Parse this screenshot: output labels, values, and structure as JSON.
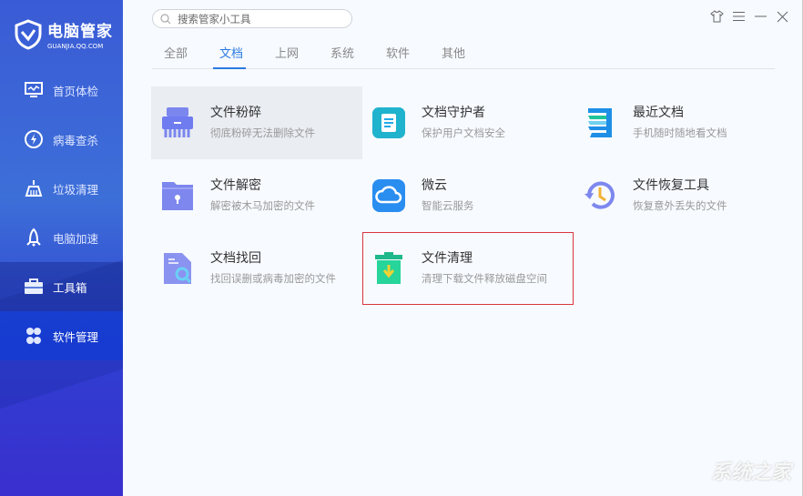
{
  "app": {
    "title": "电脑管家",
    "subtitle": "GUANJIA.QQ.COM"
  },
  "sidebar": {
    "items": [
      {
        "label": "首页体检",
        "icon": "monitor-icon"
      },
      {
        "label": "病毒查杀",
        "icon": "lightning-shield-icon"
      },
      {
        "label": "垃圾清理",
        "icon": "broom-icon"
      },
      {
        "label": "电脑加速",
        "icon": "rocket-icon"
      },
      {
        "label": "工具箱",
        "icon": "toolbox-icon"
      },
      {
        "label": "软件管理",
        "icon": "software-icon"
      }
    ]
  },
  "search": {
    "placeholder": "搜索管家小工具"
  },
  "tabs": [
    {
      "label": "全部"
    },
    {
      "label": "文档"
    },
    {
      "label": "上网"
    },
    {
      "label": "系统"
    },
    {
      "label": "软件"
    },
    {
      "label": "其他"
    }
  ],
  "tools": [
    {
      "name": "文件粉碎",
      "desc": "彻底粉碎无法删除文件"
    },
    {
      "name": "文档守护者",
      "desc": "保护用户文档安全"
    },
    {
      "name": "最近文档",
      "desc": "手机随时随地看文档"
    },
    {
      "name": "文件解密",
      "desc": "解密被木马加密的文件"
    },
    {
      "name": "微云",
      "desc": "智能云服务"
    },
    {
      "name": "文件恢复工具",
      "desc": "恢复意外丢失的文件"
    },
    {
      "name": "文档找回",
      "desc": "找回误删或病毒加密的文件"
    },
    {
      "name": "文件清理",
      "desc": "清理下载文件释放磁盘空间"
    }
  ],
  "watermark": "系统之家",
  "colors": {
    "accent": "#2a7ae2",
    "highlight": "#d9353c"
  }
}
